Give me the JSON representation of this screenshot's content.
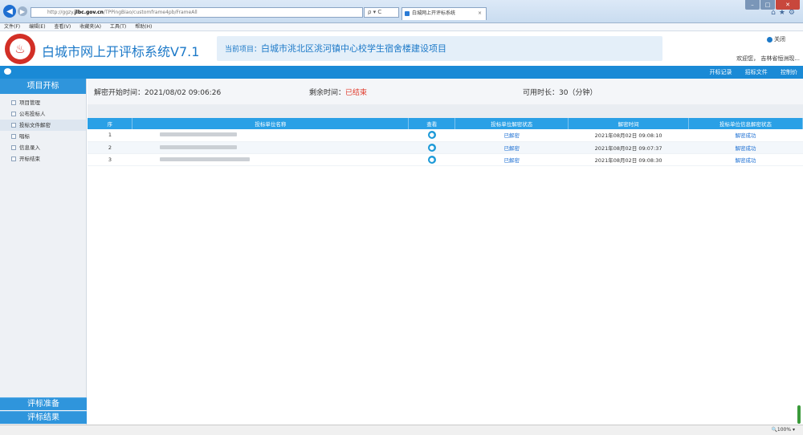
{
  "browser": {
    "url_prefix": "http://ggzy.",
    "url_host": "jlbc.gov.cn",
    "url_path": "/TPPingBiao/customframe4pb/FrameAll",
    "search_glyph": "ρ ▾ C",
    "tab_title": "白城网上开评标系统",
    "tab_close": "×",
    "menu": [
      "文件(F)",
      "编辑(E)",
      "查看(V)",
      "收藏夹(A)",
      "工具(T)",
      "帮助(H)"
    ],
    "zoom": "🔍100%  ▾"
  },
  "header": {
    "app_title": "白城市网上开评标系统V7.1",
    "project_label": "当前项目：",
    "project_name": "白城市洮北区洮河镇中心校学生宿舍楼建设项目",
    "close_label": "关闭",
    "welcome": "欢迎您， 吉林省恒洲现..."
  },
  "toplinks": [
    "开标记录",
    "招标文件",
    "控制价"
  ],
  "sidebar": {
    "title": "项目开标",
    "items": [
      "项目管理",
      "公布投标人",
      "投标文件解密",
      "唱标",
      "信息录入",
      "开标结束"
    ],
    "active_index": 2,
    "bottom_items": [
      "评标准备",
      "评标结果"
    ]
  },
  "info": {
    "start_label": "解密开始时间：",
    "start_value": "2021/08/02 09:06:26",
    "remaining_label": "剩余时间：",
    "remaining_value": "已结束",
    "duration_label": "可用时长：",
    "duration_value": "30（分钟）"
  },
  "table": {
    "headers": [
      "序",
      "投标单位名称",
      "查看",
      "投标单位解密状态",
      "解密时间",
      "投标单位信息解密状态"
    ],
    "rows": [
      {
        "no": "1",
        "status": "已解密",
        "time": "2021年08月02日 09:08:10",
        "result": "解密成功"
      },
      {
        "no": "2",
        "status": "已解密",
        "time": "2021年08月02日 09:07:37",
        "result": "解密成功"
      },
      {
        "no": "3",
        "status": "已解密",
        "time": "2021年08月02日 09:08:30",
        "result": "解密成功"
      }
    ]
  },
  "icons": {
    "view": "person-icon",
    "logo": "flame-logo-icon",
    "close": "power-icon",
    "chat": "chat-bubble-icon"
  },
  "colors": {
    "brand_blue": "#1c79c8",
    "bar_blue": "#1a8ad6",
    "header_blue": "#2aa0e6",
    "ended_red": "#e03b2c",
    "logo_red": "#d22f26"
  }
}
